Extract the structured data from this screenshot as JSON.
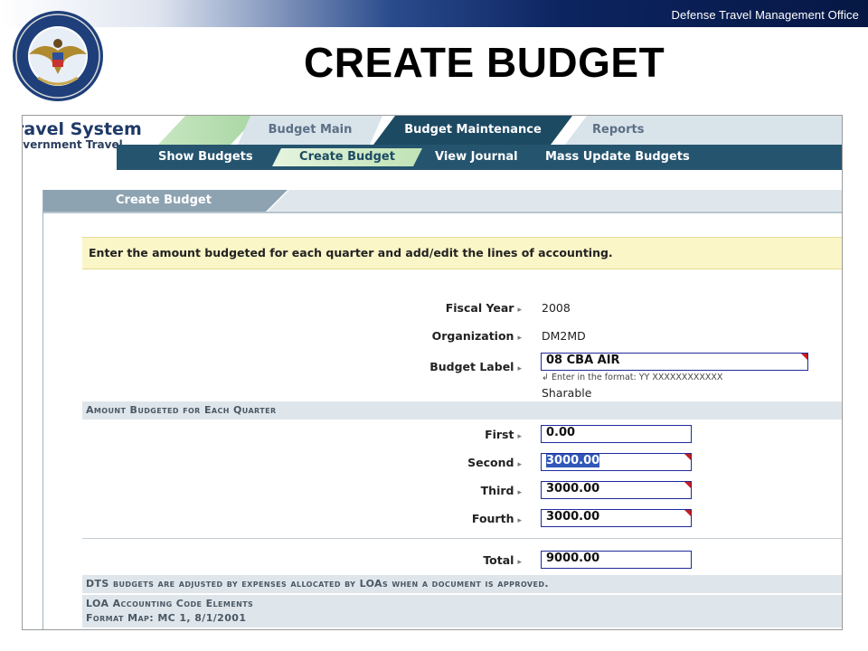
{
  "header": {
    "office_name": "Defense Travel Management Office",
    "slide_title": "CREATE BUDGET",
    "seal_icon": "dtmo-seal-icon"
  },
  "app": {
    "brand_line1": "ravel System",
    "brand_line2": "overnment Travel",
    "tabs": [
      "Budget Main",
      "Budget Maintenance",
      "Reports"
    ],
    "active_tab": "Budget Maintenance",
    "subnav": [
      "Show Budgets",
      "Create Budget",
      "View Journal",
      "Mass Update Budgets"
    ],
    "active_subnav": "Create Budget"
  },
  "panel": {
    "title": "Create Budget",
    "instruction": "Enter the amount budgeted for each quarter and add/edit the lines of accounting.",
    "fiscal_year_label": "Fiscal Year",
    "fiscal_year": "2008",
    "organization_label": "Organization",
    "organization": "DM2MD",
    "budget_label_label": "Budget Label",
    "budget_label": "08 CBA AIR",
    "budget_label_hint": "Enter in the format: YY XXXXXXXXXXXX",
    "sharable": "Sharable",
    "amount_section": "Amount Budgeted for Each Quarter",
    "quarters": [
      {
        "label": "First",
        "value": "0.00"
      },
      {
        "label": "Second",
        "value": "3000.00"
      },
      {
        "label": "Third",
        "value": "3000.00"
      },
      {
        "label": "Fourth",
        "value": "3000.00"
      }
    ],
    "total_label": "Total",
    "total": "9000.00",
    "dts_note": "DTS budgets are adjusted by expenses allocated by LOAs when a document is approved.",
    "loa_title": "LOA Accounting Code Elements",
    "format_map": "Format Map: MC 1, 8/1/2001"
  },
  "colors": {
    "nav_dark": "#1d4a63",
    "nav_light": "#d9e3ea",
    "instruction_bg": "#fbf6c7",
    "field_border": "#1e2a9c",
    "required_marker": "#cc1b1b"
  }
}
